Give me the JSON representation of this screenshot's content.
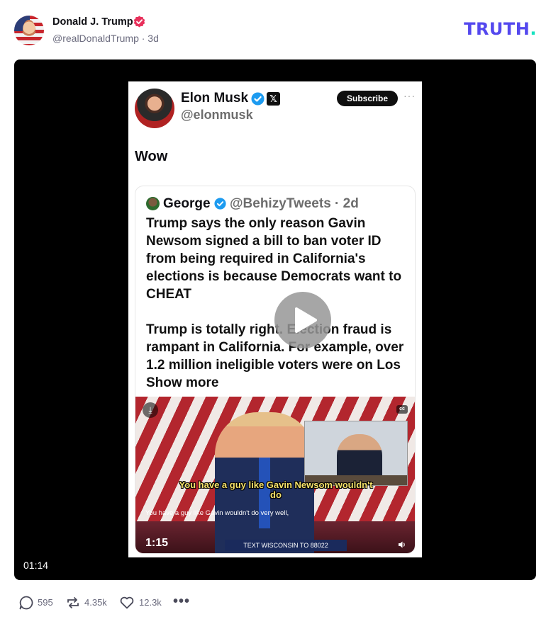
{
  "post": {
    "author_name": "Donald J. Trump",
    "author_handle": "@realDonaldTrump · 3d",
    "brand_logo": "TRUTH",
    "brand_dot": ".",
    "brand_colors": {
      "primary": "#5448ee",
      "accent": "#17e2c0"
    }
  },
  "video": {
    "duration": "01:14",
    "embedded": {
      "author_name": "Elon Musk",
      "author_handle": "@elonmusk",
      "x_badge": "𝕏",
      "subscribe_label": "Subscribe",
      "more_label": "···",
      "text": "Wow",
      "quote": {
        "author_name": "George",
        "author_handle": "@BehizyTweets · 2d",
        "paragraph_1": "Trump says the only reason Gavin Newsom signed a bill to ban voter ID from being required in California's elections is because Democrats want to CHEAT",
        "paragraph_2": "Trump is totally right. Election fraud is rampant in California. For example, over 1.2 million ineligible voters were on Los Show more",
        "video": {
          "caption": "You have a guy like Gavin Newsom wouldn't do",
          "subtitle": "You have a guy like Gavin wouldn't do very well,",
          "time": "1:15",
          "banner": "TEXT WISCONSIN TO 88022",
          "download_icon": "download-icon",
          "cc_label": "cc"
        }
      }
    }
  },
  "actions": {
    "replies": "595",
    "retruths": "4.35k",
    "likes": "12.3k",
    "more": "•••"
  }
}
